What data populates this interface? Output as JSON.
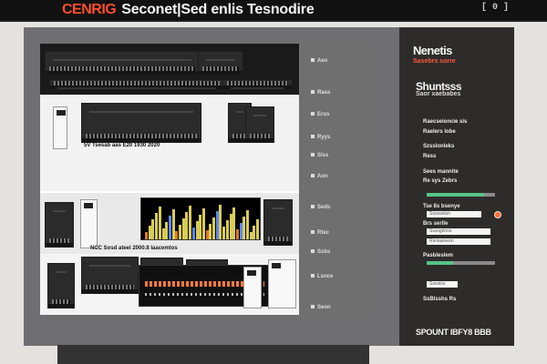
{
  "app": {
    "brand_mark": "CENRIG",
    "title": "Seconet|Sed enlis Tesnodire",
    "window_tag": "[ 0 ]"
  },
  "main": {
    "caption_1": "5V Tsesab aas E20 1930 2020",
    "caption_2": "NCC Sosd ateel 2000.8 Iaacemtos"
  },
  "overlay": {
    "rows": [
      "Aeo",
      "Rass",
      "Eros",
      "Ryys",
      "Siss",
      "Aon",
      "Seds",
      "Rtec",
      "Ssbs",
      "Lsnce",
      "Seon"
    ]
  },
  "sidebar": {
    "title": "Nenetis",
    "subtitle": "Sasebrs sorre",
    "section_heading": "Shuntsss",
    "section_subheading": "Saor xaebabes",
    "labels": [
      "Raecseioncie sis",
      "Raelers lobe",
      "Szsslonleks",
      "Ress",
      "Sees mannite",
      "Re sys Zebrs",
      "Tse 8s bsenye",
      "Brs serlle",
      "Pasbleslem",
      "SsBlsshs Rs"
    ],
    "meter_1": 0.84,
    "meter_2": 0.38,
    "field_1_value": "Sosssolsn",
    "field_2_value": "Ssssgrinos",
    "field_3_value": "Rsniaaoeon",
    "field_4_value": "Sseslos",
    "bottom_line": "SPOUNT IBFY8 BBB"
  },
  "colors": {
    "accent": "#ff4d2e",
    "meter": "#56c48a",
    "dark_panel": "#2e2c2b"
  }
}
